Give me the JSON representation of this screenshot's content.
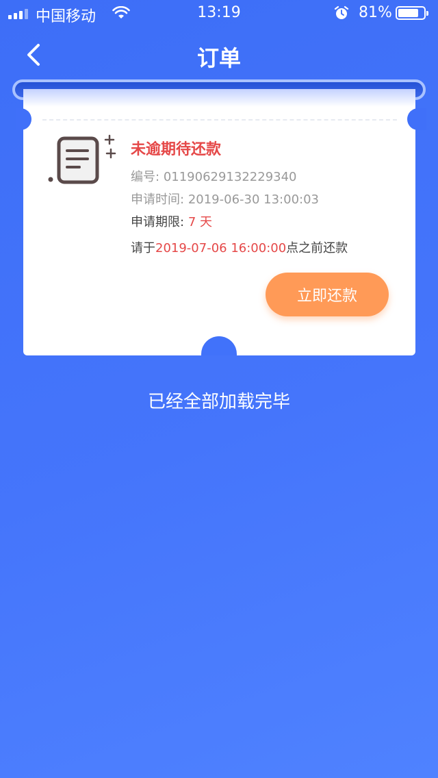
{
  "status_bar": {
    "carrier": "中国移动",
    "time": "13:19",
    "battery_percent": "81%",
    "battery_level": 0.81
  },
  "nav": {
    "title": "订单"
  },
  "order": {
    "status": "未逾期待还款",
    "number_label": "编号:",
    "number_value": "01190629132229340",
    "apply_time_label": "申请时间:",
    "apply_time_value": "2019-06-30 13:00:03",
    "term_label": "申请期限:",
    "term_value": "7 天",
    "due_prefix": "请于",
    "due_datetime": "2019-07-06 16:00:00",
    "due_suffix": "点之前还款",
    "repay_button": "立即还款"
  },
  "footer": {
    "loaded_text": "已经全部加载完毕"
  },
  "colors": {
    "background": "#4575fb",
    "accent_red": "#e54848",
    "button_orange": "#ff9a57"
  },
  "icons": [
    "signal-icon",
    "wifi-icon",
    "alarm-icon",
    "battery-icon",
    "back-arrow-icon",
    "document-icon"
  ]
}
